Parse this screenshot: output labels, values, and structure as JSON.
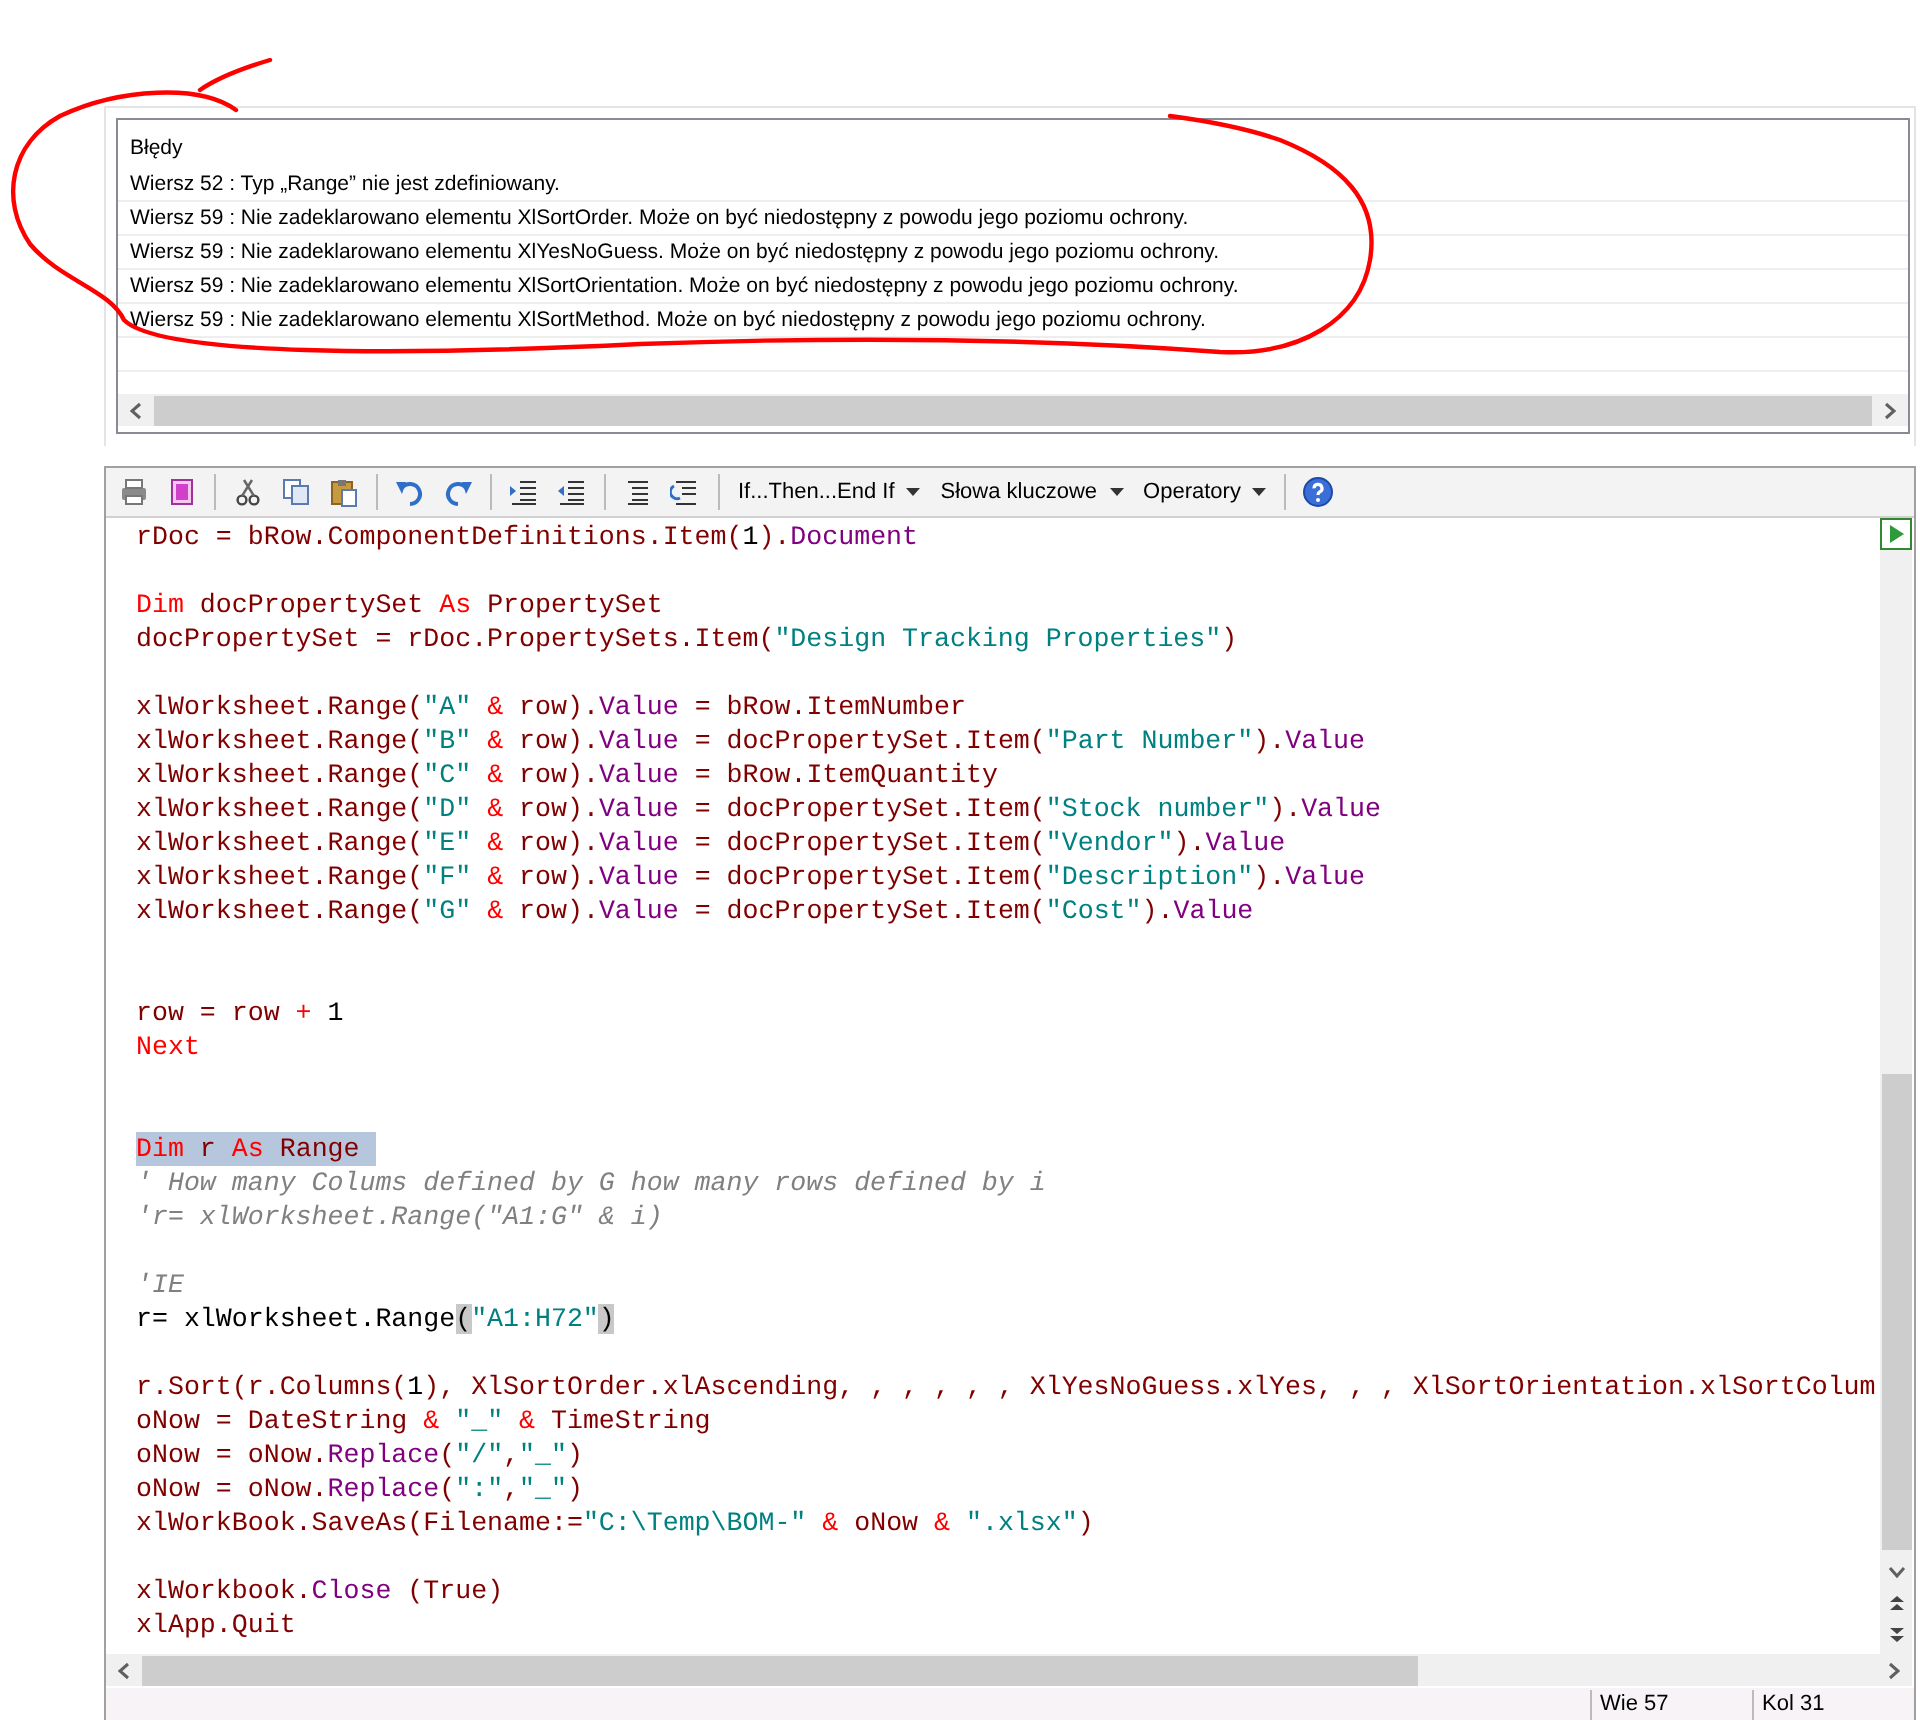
{
  "errors": {
    "title": "Błędy",
    "rows": [
      "Wiersz 52 : Typ „Range” nie jest zdefiniowany.",
      "Wiersz 59 : Nie zadeklarowano elementu XlSortOrder. Może on być niedostępny z powodu jego poziomu ochrony.",
      "Wiersz 59 : Nie zadeklarowano elementu XlYesNoGuess. Może on być niedostępny z powodu jego poziomu ochrony.",
      "Wiersz 59 : Nie zadeklarowano elementu XlSortOrientation. Może on być niedostępny z powodu jego poziomu ochrony.",
      "Wiersz 59 : Nie zadeklarowano elementu XlSortMethod. Może on być niedostępny z powodu jego poziomu ochrony."
    ]
  },
  "toolbar": {
    "menus": [
      "If...Then...End If",
      "Słowa kluczowe",
      "Operatory"
    ]
  },
  "code": {
    "lines": [
      {
        "kind": "code",
        "selected": false,
        "tokens": [
          {
            "kind": "plain",
            "text": "rDoc = bRow.ComponentDefinitions.Item("
          },
          {
            "kind": "number",
            "text": "1"
          },
          {
            "kind": "plain",
            "text": ")."
          },
          {
            "kind": "member",
            "text": "Document"
          }
        ]
      },
      {
        "kind": "blank"
      },
      {
        "kind": "code",
        "selected": false,
        "tokens": [
          {
            "kind": "keyword",
            "text": "Dim"
          },
          {
            "kind": "plain",
            "text": " docPropertySet "
          },
          {
            "kind": "keyword",
            "text": "As"
          },
          {
            "kind": "plain",
            "text": " PropertySet"
          }
        ]
      },
      {
        "kind": "code",
        "selected": false,
        "tokens": [
          {
            "kind": "plain",
            "text": "docPropertySet = rDoc.PropertySets.Item("
          },
          {
            "kind": "string",
            "text": "\"Design Tracking Properties\""
          },
          {
            "kind": "plain",
            "text": ")"
          }
        ]
      },
      {
        "kind": "blank"
      },
      {
        "kind": "code",
        "selected": false,
        "tokens": [
          {
            "kind": "plain",
            "text": "xlWorksheet.Range("
          },
          {
            "kind": "string",
            "text": "\"A\""
          },
          {
            "kind": "keyword",
            "text": " &"
          },
          {
            "kind": "plain",
            "text": " row)."
          },
          {
            "kind": "member",
            "text": "Value"
          },
          {
            "kind": "plain",
            "text": " = bRow.ItemNumber"
          }
        ]
      },
      {
        "kind": "code",
        "selected": false,
        "tokens": [
          {
            "kind": "plain",
            "text": "xlWorksheet.Range("
          },
          {
            "kind": "string",
            "text": "\"B\""
          },
          {
            "kind": "keyword",
            "text": " &"
          },
          {
            "kind": "plain",
            "text": " row)."
          },
          {
            "kind": "member",
            "text": "Value"
          },
          {
            "kind": "plain",
            "text": " = docPropertySet.Item("
          },
          {
            "kind": "string",
            "text": "\"Part Number\""
          },
          {
            "kind": "plain",
            "text": ")."
          },
          {
            "kind": "member",
            "text": "Value"
          }
        ]
      },
      {
        "kind": "code",
        "selected": false,
        "tokens": [
          {
            "kind": "plain",
            "text": "xlWorksheet.Range("
          },
          {
            "kind": "string",
            "text": "\"C\""
          },
          {
            "kind": "keyword",
            "text": " &"
          },
          {
            "kind": "plain",
            "text": " row)."
          },
          {
            "kind": "member",
            "text": "Value"
          },
          {
            "kind": "plain",
            "text": " = bRow.ItemQuantity"
          }
        ]
      },
      {
        "kind": "code",
        "selected": false,
        "tokens": [
          {
            "kind": "plain",
            "text": "xlWorksheet.Range("
          },
          {
            "kind": "string",
            "text": "\"D\""
          },
          {
            "kind": "keyword",
            "text": " &"
          },
          {
            "kind": "plain",
            "text": " row)."
          },
          {
            "kind": "member",
            "text": "Value"
          },
          {
            "kind": "plain",
            "text": " = docPropertySet.Item("
          },
          {
            "kind": "string",
            "text": "\"Stock number\""
          },
          {
            "kind": "plain",
            "text": ")."
          },
          {
            "kind": "member",
            "text": "Value"
          }
        ]
      },
      {
        "kind": "code",
        "selected": false,
        "tokens": [
          {
            "kind": "plain",
            "text": "xlWorksheet.Range("
          },
          {
            "kind": "string",
            "text": "\"E\""
          },
          {
            "kind": "keyword",
            "text": " &"
          },
          {
            "kind": "plain",
            "text": " row)."
          },
          {
            "kind": "member",
            "text": "Value"
          },
          {
            "kind": "plain",
            "text": " = docPropertySet.Item("
          },
          {
            "kind": "string",
            "text": "\"Vendor\""
          },
          {
            "kind": "plain",
            "text": ")."
          },
          {
            "kind": "member",
            "text": "Value"
          }
        ]
      },
      {
        "kind": "code",
        "selected": false,
        "tokens": [
          {
            "kind": "plain",
            "text": "xlWorksheet.Range("
          },
          {
            "kind": "string",
            "text": "\"F\""
          },
          {
            "kind": "keyword",
            "text": " &"
          },
          {
            "kind": "plain",
            "text": " row)."
          },
          {
            "kind": "member",
            "text": "Value"
          },
          {
            "kind": "plain",
            "text": " = docPropertySet.Item("
          },
          {
            "kind": "string",
            "text": "\"Description\""
          },
          {
            "kind": "plain",
            "text": ")."
          },
          {
            "kind": "member",
            "text": "Value"
          }
        ]
      },
      {
        "kind": "code",
        "selected": false,
        "tokens": [
          {
            "kind": "plain",
            "text": "xlWorksheet.Range("
          },
          {
            "kind": "string",
            "text": "\"G\""
          },
          {
            "kind": "keyword",
            "text": " &"
          },
          {
            "kind": "plain",
            "text": " row)."
          },
          {
            "kind": "member",
            "text": "Value"
          },
          {
            "kind": "plain",
            "text": " = docPropertySet.Item("
          },
          {
            "kind": "string",
            "text": "\"Cost\""
          },
          {
            "kind": "plain",
            "text": ")."
          },
          {
            "kind": "member",
            "text": "Value"
          }
        ]
      },
      {
        "kind": "blank"
      },
      {
        "kind": "blank"
      },
      {
        "kind": "code",
        "selected": false,
        "tokens": [
          {
            "kind": "plain",
            "text": "row = row "
          },
          {
            "kind": "keyword",
            "text": "+"
          },
          {
            "kind": "number",
            "text": " 1"
          }
        ]
      },
      {
        "kind": "code",
        "selected": false,
        "tokens": [
          {
            "kind": "keyword",
            "text": "Next"
          }
        ]
      },
      {
        "kind": "blank"
      },
      {
        "kind": "blank"
      },
      {
        "kind": "code",
        "selected": true,
        "tokens": [
          {
            "kind": "keyword",
            "text": "Dim"
          },
          {
            "kind": "plain",
            "text": " r "
          },
          {
            "kind": "keyword",
            "text": "As"
          },
          {
            "kind": "plain",
            "text": " Range"
          }
        ]
      },
      {
        "kind": "code",
        "selected": false,
        "tokens": [
          {
            "kind": "comment",
            "text": "' How many Colums defined by G how many rows defined by i"
          }
        ]
      },
      {
        "kind": "code",
        "selected": false,
        "tokens": [
          {
            "kind": "comment",
            "text": "'r= xlWorksheet.Range(\"A1:G\" & i)"
          }
        ]
      },
      {
        "kind": "blank"
      },
      {
        "kind": "code",
        "selected": false,
        "tokens": [
          {
            "kind": "comment",
            "text": "'IE"
          }
        ]
      },
      {
        "kind": "code",
        "selected": false,
        "tokens": [
          {
            "kind": "number",
            "text": "r= xlWorksheet.Range"
          },
          {
            "kind": "brace",
            "text": "("
          },
          {
            "kind": "string",
            "text": "\"A1:H72\""
          },
          {
            "kind": "brace",
            "text": ")"
          }
        ]
      },
      {
        "kind": "blank"
      },
      {
        "kind": "code",
        "selected": false,
        "tokens": [
          {
            "kind": "plain",
            "text": "r.Sort(r.Columns("
          },
          {
            "kind": "number",
            "text": "1"
          },
          {
            "kind": "plain",
            "text": "), XlSortOrder.xlAscending, , , , , , XlYesNoGuess.xlYes, , , XlSortOrientation.xlSortColum"
          }
        ]
      },
      {
        "kind": "code",
        "selected": false,
        "tokens": [
          {
            "kind": "plain",
            "text": "oNow = DateString "
          },
          {
            "kind": "keyword",
            "text": "&"
          },
          {
            "kind": "string",
            "text": " \"_\""
          },
          {
            "kind": "keyword",
            "text": " &"
          },
          {
            "kind": "plain",
            "text": " TimeString"
          }
        ]
      },
      {
        "kind": "code",
        "selected": false,
        "tokens": [
          {
            "kind": "plain",
            "text": "oNow = oNow."
          },
          {
            "kind": "member",
            "text": "Replace"
          },
          {
            "kind": "plain",
            "text": "("
          },
          {
            "kind": "string",
            "text": "\"/\""
          },
          {
            "kind": "plain",
            "text": ","
          },
          {
            "kind": "string",
            "text": "\"_\""
          },
          {
            "kind": "plain",
            "text": ")"
          }
        ]
      },
      {
        "kind": "code",
        "selected": false,
        "tokens": [
          {
            "kind": "plain",
            "text": "oNow = oNow."
          },
          {
            "kind": "member",
            "text": "Replace"
          },
          {
            "kind": "plain",
            "text": "("
          },
          {
            "kind": "string",
            "text": "\":\""
          },
          {
            "kind": "plain",
            "text": ","
          },
          {
            "kind": "string",
            "text": "\"_\""
          },
          {
            "kind": "plain",
            "text": ")"
          }
        ]
      },
      {
        "kind": "code",
        "selected": false,
        "tokens": [
          {
            "kind": "plain",
            "text": "xlWorkBook.SaveAs(Filename:="
          },
          {
            "kind": "string",
            "text": "\"C:\\Temp\\BOM-\""
          },
          {
            "kind": "keyword",
            "text": " &"
          },
          {
            "kind": "plain",
            "text": " oNow "
          },
          {
            "kind": "keyword",
            "text": "&"
          },
          {
            "kind": "string",
            "text": " \".xlsx\""
          },
          {
            "kind": "plain",
            "text": ")"
          }
        ]
      },
      {
        "kind": "blank"
      },
      {
        "kind": "code",
        "selected": false,
        "tokens": [
          {
            "kind": "plain",
            "text": "xlWorkbook."
          },
          {
            "kind": "member",
            "text": "Close"
          },
          {
            "kind": "plain",
            "text": " (True)"
          }
        ]
      },
      {
        "kind": "code",
        "selected": false,
        "tokens": [
          {
            "kind": "plain",
            "text": "xlApp.Quit"
          }
        ]
      }
    ]
  },
  "status_bar": [
    "Wie 57",
    "Kol 31"
  ]
}
